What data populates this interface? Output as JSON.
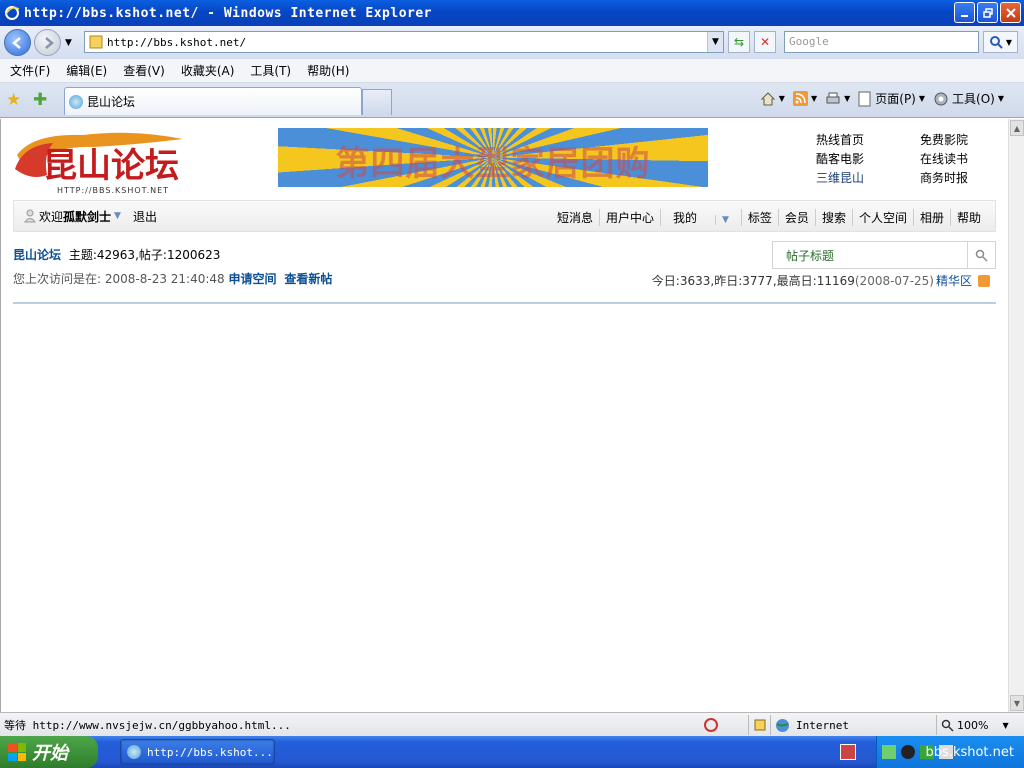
{
  "window": {
    "title": "http://bbs.kshot.net/ - Windows Internet Explorer"
  },
  "address": {
    "url": "http://bbs.kshot.net/"
  },
  "search_engine": {
    "placeholder": "Google"
  },
  "menu": [
    "文件(F)",
    "编辑(E)",
    "查看(V)",
    "收藏夹(A)",
    "工具(T)",
    "帮助(H)"
  ],
  "tab": {
    "label": "昆山论坛"
  },
  "toolbar": {
    "page_label": "页面(P)",
    "tools_label": "工具(O)"
  },
  "site": {
    "logo_text": "昆山论坛",
    "logo_url": "HTTP://BBS.KSHOT.NET",
    "banner_text": "第四届大型家居团购",
    "top_links": [
      "热线首页",
      "免费影院",
      "酷客电影",
      "在线读书",
      "三维昆山",
      "商务时报"
    ]
  },
  "userbar": {
    "welcome": "欢迎",
    "username": "孤默剑士",
    "logout": "退出",
    "nav": [
      "短消息",
      "用户中心",
      "我的",
      "标签",
      "会员",
      "搜索",
      "个人空间",
      "相册",
      "帮助"
    ]
  },
  "stats": {
    "forum_name": "昆山论坛",
    "topics_label": "主题:",
    "topics": "42963",
    "posts_label": "帖子:",
    "posts": "1200623",
    "last_visit": "您上次访问是在: 2008-8-23 21:40:48",
    "apply_space": "申请空间",
    "view_new": "查看新帖",
    "today_label": "今日:",
    "today": "3633",
    "yesterday_label": "昨日:",
    "yesterday": "3777",
    "max_label": "最高日:",
    "max": "11169",
    "max_date": "(2008-07-25)",
    "digest": "精华区"
  },
  "search": {
    "label": "帖子标题"
  },
  "statusbar": {
    "message": "等待 http://www.nvsjejw.cn/ggbbyahoo.html...",
    "zone": "Internet",
    "zoom": "100%"
  },
  "taskbar": {
    "start": "开始",
    "item": "http://bbs.kshot...",
    "clock": "bbs.kshot.net"
  }
}
